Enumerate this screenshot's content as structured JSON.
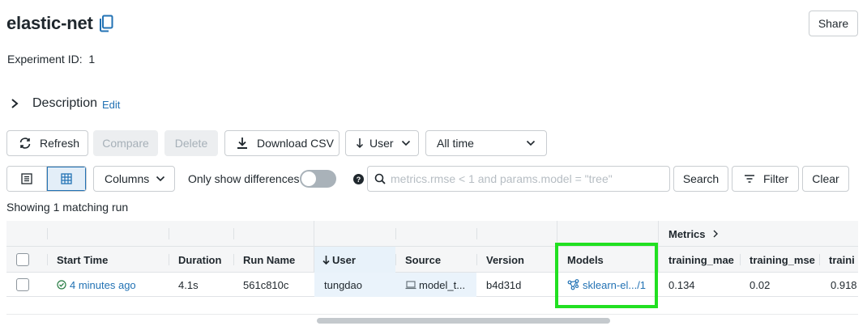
{
  "experiment": {
    "title": "elastic-net",
    "id_label": "Experiment ID",
    "id_sep": ":",
    "id_value": "1",
    "share_label": "Share"
  },
  "description": {
    "label": "Description",
    "edit_label": "Edit"
  },
  "toolbar": {
    "refresh_label": "Refresh",
    "compare_label": "Compare",
    "delete_label": "Delete",
    "download_label": "Download CSV",
    "sort_label": "User",
    "time_label": "All time",
    "columns_label": "Columns",
    "diff_label": "Only show differences",
    "search_placeholder": "metrics.rmse < 1 and params.model = \"tree\"",
    "search_label": "Search",
    "filter_label": "Filter",
    "clear_label": "Clear"
  },
  "status": {
    "showing": "Showing 1 matching run"
  },
  "table": {
    "group_metrics": "Metrics",
    "headers": {
      "start_time": "Start Time",
      "duration": "Duration",
      "run_name": "Run Name",
      "user": "User",
      "source": "Source",
      "version": "Version",
      "models": "Models",
      "training_mae": "training_mae",
      "training_mse": "training_mse",
      "training_next": "traini"
    },
    "rows": [
      {
        "start_time": "4 minutes ago",
        "duration": "4.1s",
        "run_name": "561c810c",
        "user": "tungdao",
        "source": "model_t...",
        "version": "b4d31d",
        "model": "sklearn-el.../1",
        "training_mae": "0.134",
        "training_mse": "0.02",
        "training_next": "0.918"
      }
    ]
  },
  "colors": {
    "accent": "#2272b4",
    "highlight": "#21e021",
    "success": "#277c43"
  },
  "icons": {
    "copy": "copy-icon",
    "refresh": "refresh-icon",
    "download": "download-icon",
    "sort": "arrow-down-icon",
    "help": "help-icon",
    "search": "search-icon",
    "filter": "filter-icon",
    "model": "model-icon",
    "source": "laptop-icon",
    "status": "check-circle-icon"
  }
}
